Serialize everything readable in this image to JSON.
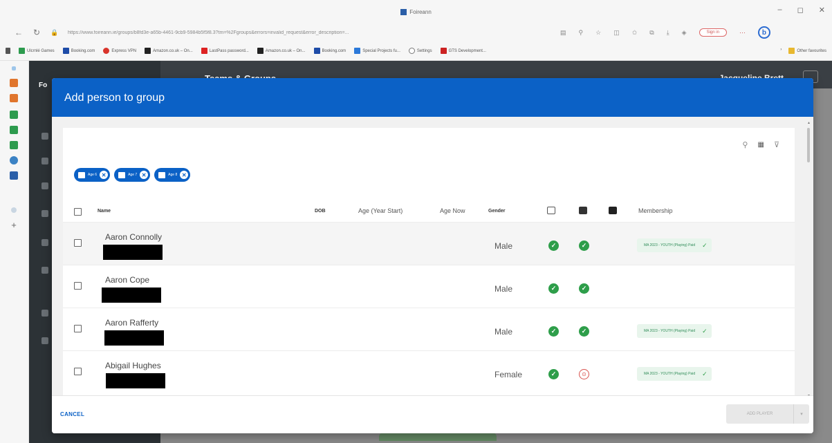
{
  "browser": {
    "tab_title": "Foireann",
    "url": "https://www.foireann.ie/groups/b8fd3e-a65b-4461-9cb9-5984b5f5f8.3?tm=%2Fgroups&errors=invalid_request&error_description=...",
    "signin_label": "Sign in",
    "edge_letter": "b",
    "bookmarks": [
      "Ulcrnlé Games",
      "Booking.com",
      "Express VPN",
      "Amazon.co.uk – On...",
      "LastPass password...",
      "Amazon.co.uk – On...",
      "Booking.com",
      "Special Projects fu...",
      "Settings",
      "GTS Development..."
    ],
    "other_favourites": "Other favourites"
  },
  "app": {
    "brand": "Fo",
    "title": "Teams & Groups",
    "user": "Jacqueline Brett"
  },
  "modal": {
    "title": "Add person to group",
    "filter_chips": [
      "Age 6",
      "Age 7",
      "Age 8"
    ],
    "columns": {
      "name": "Name",
      "dob": "DOB",
      "age_year_start": "Age (Year Start)",
      "age_now": "Age Now",
      "gender": "Gender",
      "membership": "Membership"
    },
    "rows": [
      {
        "name": "Aaron Connolly",
        "gender": "Male",
        "membership": "MA 2023 - YOUTH (Playing) Paid"
      },
      {
        "name": "Aaron Cope",
        "gender": "Male",
        "membership": ""
      },
      {
        "name": "Aaron Rafferty",
        "gender": "Male",
        "membership": "MA 2023 - YOUTH (Playing) Paid"
      },
      {
        "name": "Abigail Hughes",
        "gender": "Female",
        "membership": "MA 2023 - YOUTH (Playing) Paid"
      }
    ],
    "cancel_label": "CANCEL",
    "add_label": "ADD PLAYER"
  },
  "colors": {
    "primary": "#0b61c6",
    "success": "#2e9e4a",
    "danger": "#d9534f"
  }
}
